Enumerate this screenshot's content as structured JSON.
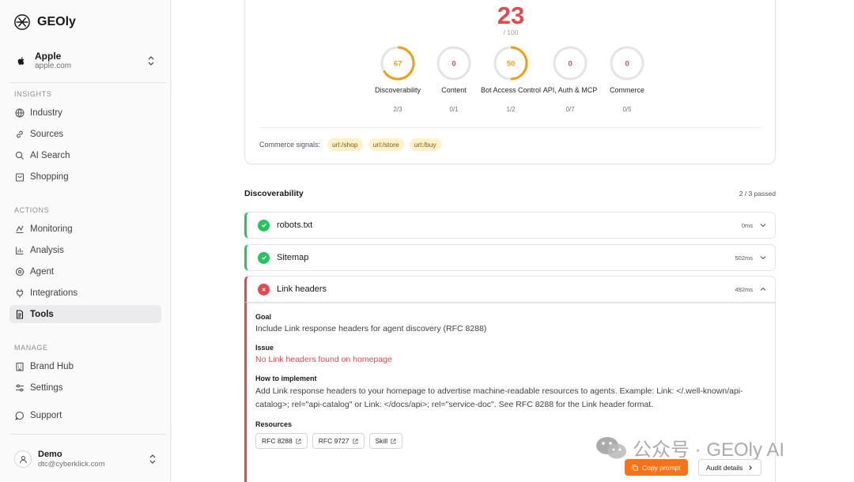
{
  "app": {
    "name": "GEOly"
  },
  "org": {
    "name": "Apple",
    "domain": "apple.com"
  },
  "sidebar": {
    "sections": [
      {
        "label": "INSIGHTS",
        "items": [
          {
            "label": "Industry",
            "icon": "globe-icon"
          },
          {
            "label": "Sources",
            "icon": "link-icon"
          },
          {
            "label": "AI Search",
            "icon": "search-icon"
          },
          {
            "label": "Shopping",
            "icon": "bag-icon"
          }
        ]
      },
      {
        "label": "ACTIONS",
        "items": [
          {
            "label": "Monitoring",
            "icon": "monitoring-icon"
          },
          {
            "label": "Analysis",
            "icon": "bar-chart-icon"
          },
          {
            "label": "Agent",
            "icon": "agent-icon"
          },
          {
            "label": "Integrations",
            "icon": "plug-icon"
          },
          {
            "label": "Tools",
            "icon": "document-icon",
            "active": true
          }
        ]
      },
      {
        "label": "MANAGE",
        "items": [
          {
            "label": "Brand Hub",
            "icon": "building-icon"
          },
          {
            "label": "Settings",
            "icon": "sliders-icon"
          }
        ]
      }
    ],
    "support": {
      "label": "Support",
      "icon": "chat-icon"
    }
  },
  "user": {
    "name": "Demo",
    "email": "dtc@cyberklick.com"
  },
  "score": {
    "value": "23",
    "total": "/ 100",
    "fraction": 0.23,
    "color": "#e5484d"
  },
  "metrics": [
    {
      "value": "67",
      "fraction": 0.67,
      "name": "Discoverability",
      "sub": "2/3",
      "color": "#f59e0b"
    },
    {
      "value": "0",
      "fraction": 0,
      "name": "Content",
      "sub": "0/1",
      "color": "#e5484d"
    },
    {
      "value": "50",
      "fraction": 0.5,
      "name": "Bot Access Control",
      "sub": "1/2",
      "color": "#f59e0b"
    },
    {
      "value": "0",
      "fraction": 0,
      "name": "API, Auth & MCP",
      "sub": "0/7",
      "color": "#e5484d"
    },
    {
      "value": "0",
      "fraction": 0,
      "name": "Commerce",
      "sub": "0/5",
      "color": "#e5484d"
    }
  ],
  "signals": {
    "label": "Commerce signals:",
    "chips": [
      "url:/shop",
      "url:/store",
      "url:/buy"
    ]
  },
  "discoverability": {
    "title": "Discoverability",
    "passed": "2 / 3 passed"
  },
  "checks": [
    {
      "label": "robots.txt",
      "time": "0ms",
      "status": "pass"
    },
    {
      "label": "Sitemap",
      "time": "502ms",
      "status": "pass"
    },
    {
      "label": "Link headers",
      "time": "492ms",
      "status": "fail",
      "expanded": true
    }
  ],
  "detail": {
    "goal_head": "Goal",
    "goal": "Include Link response headers for agent discovery (RFC 8288)",
    "issue_head": "Issue",
    "issue": "No Link headers found on homepage",
    "how_head": "How to implement",
    "how": "Add Link response headers to your homepage to advertise machine-readable resources to agents. Example: Link: </.well-known/api-catalog>; rel=\"api-catalog\" or Link: </docs/api>; rel=\"service-doc\". See RFC 8288 for the Link header format.",
    "resources_head": "Resources",
    "resources": [
      "RFC 8288",
      "RFC 9727",
      "Skill"
    ]
  },
  "actions": {
    "copy": "Copy prompt",
    "audit": "Audit details"
  },
  "watermark": "公众号 · GEOly AI"
}
